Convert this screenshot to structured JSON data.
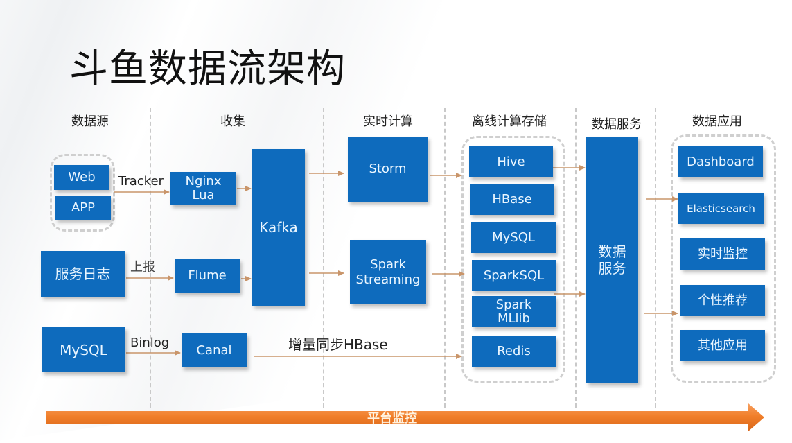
{
  "title": "斗鱼数据流架构",
  "columns": [
    {
      "id": "source",
      "label": "数据源"
    },
    {
      "id": "collect",
      "label": "收集"
    },
    {
      "id": "realtime",
      "label": "实时计算"
    },
    {
      "id": "offline",
      "label": "离线计算存储"
    },
    {
      "id": "service",
      "label": "数据服务"
    },
    {
      "id": "apps",
      "label": "数据应用"
    }
  ],
  "sources": {
    "web": "Web",
    "app": "APP",
    "service_log": "服务日志",
    "mysql": "MySQL"
  },
  "collect": {
    "nginx_lua": "Nginx\nLua",
    "flume": "Flume",
    "canal": "Canal",
    "kafka": "Kafka"
  },
  "edge_labels": {
    "tracker": "Tracker",
    "report": "上报",
    "binlog": "Binlog",
    "incremental_sync": "增量同步HBase"
  },
  "realtime": {
    "storm": "Storm",
    "spark_streaming": "Spark\nStreaming"
  },
  "offline": {
    "items": [
      "Hive",
      "HBase",
      "MySQL",
      "SparkSQL",
      "Spark\nMLlib",
      "Redis"
    ]
  },
  "service": {
    "label": "数据\n服务"
  },
  "apps": {
    "items": [
      "Dashboard",
      "Elasticsearch",
      "实时监控",
      "个性推荐",
      "其他应用"
    ]
  },
  "platform_monitor": "平台监控",
  "colors": {
    "box": "#0e6bbd",
    "box_text": "#eaf6ff",
    "arrow": "#c9956a",
    "platform": "#f07f2c",
    "divider": "#c9c9c9"
  }
}
